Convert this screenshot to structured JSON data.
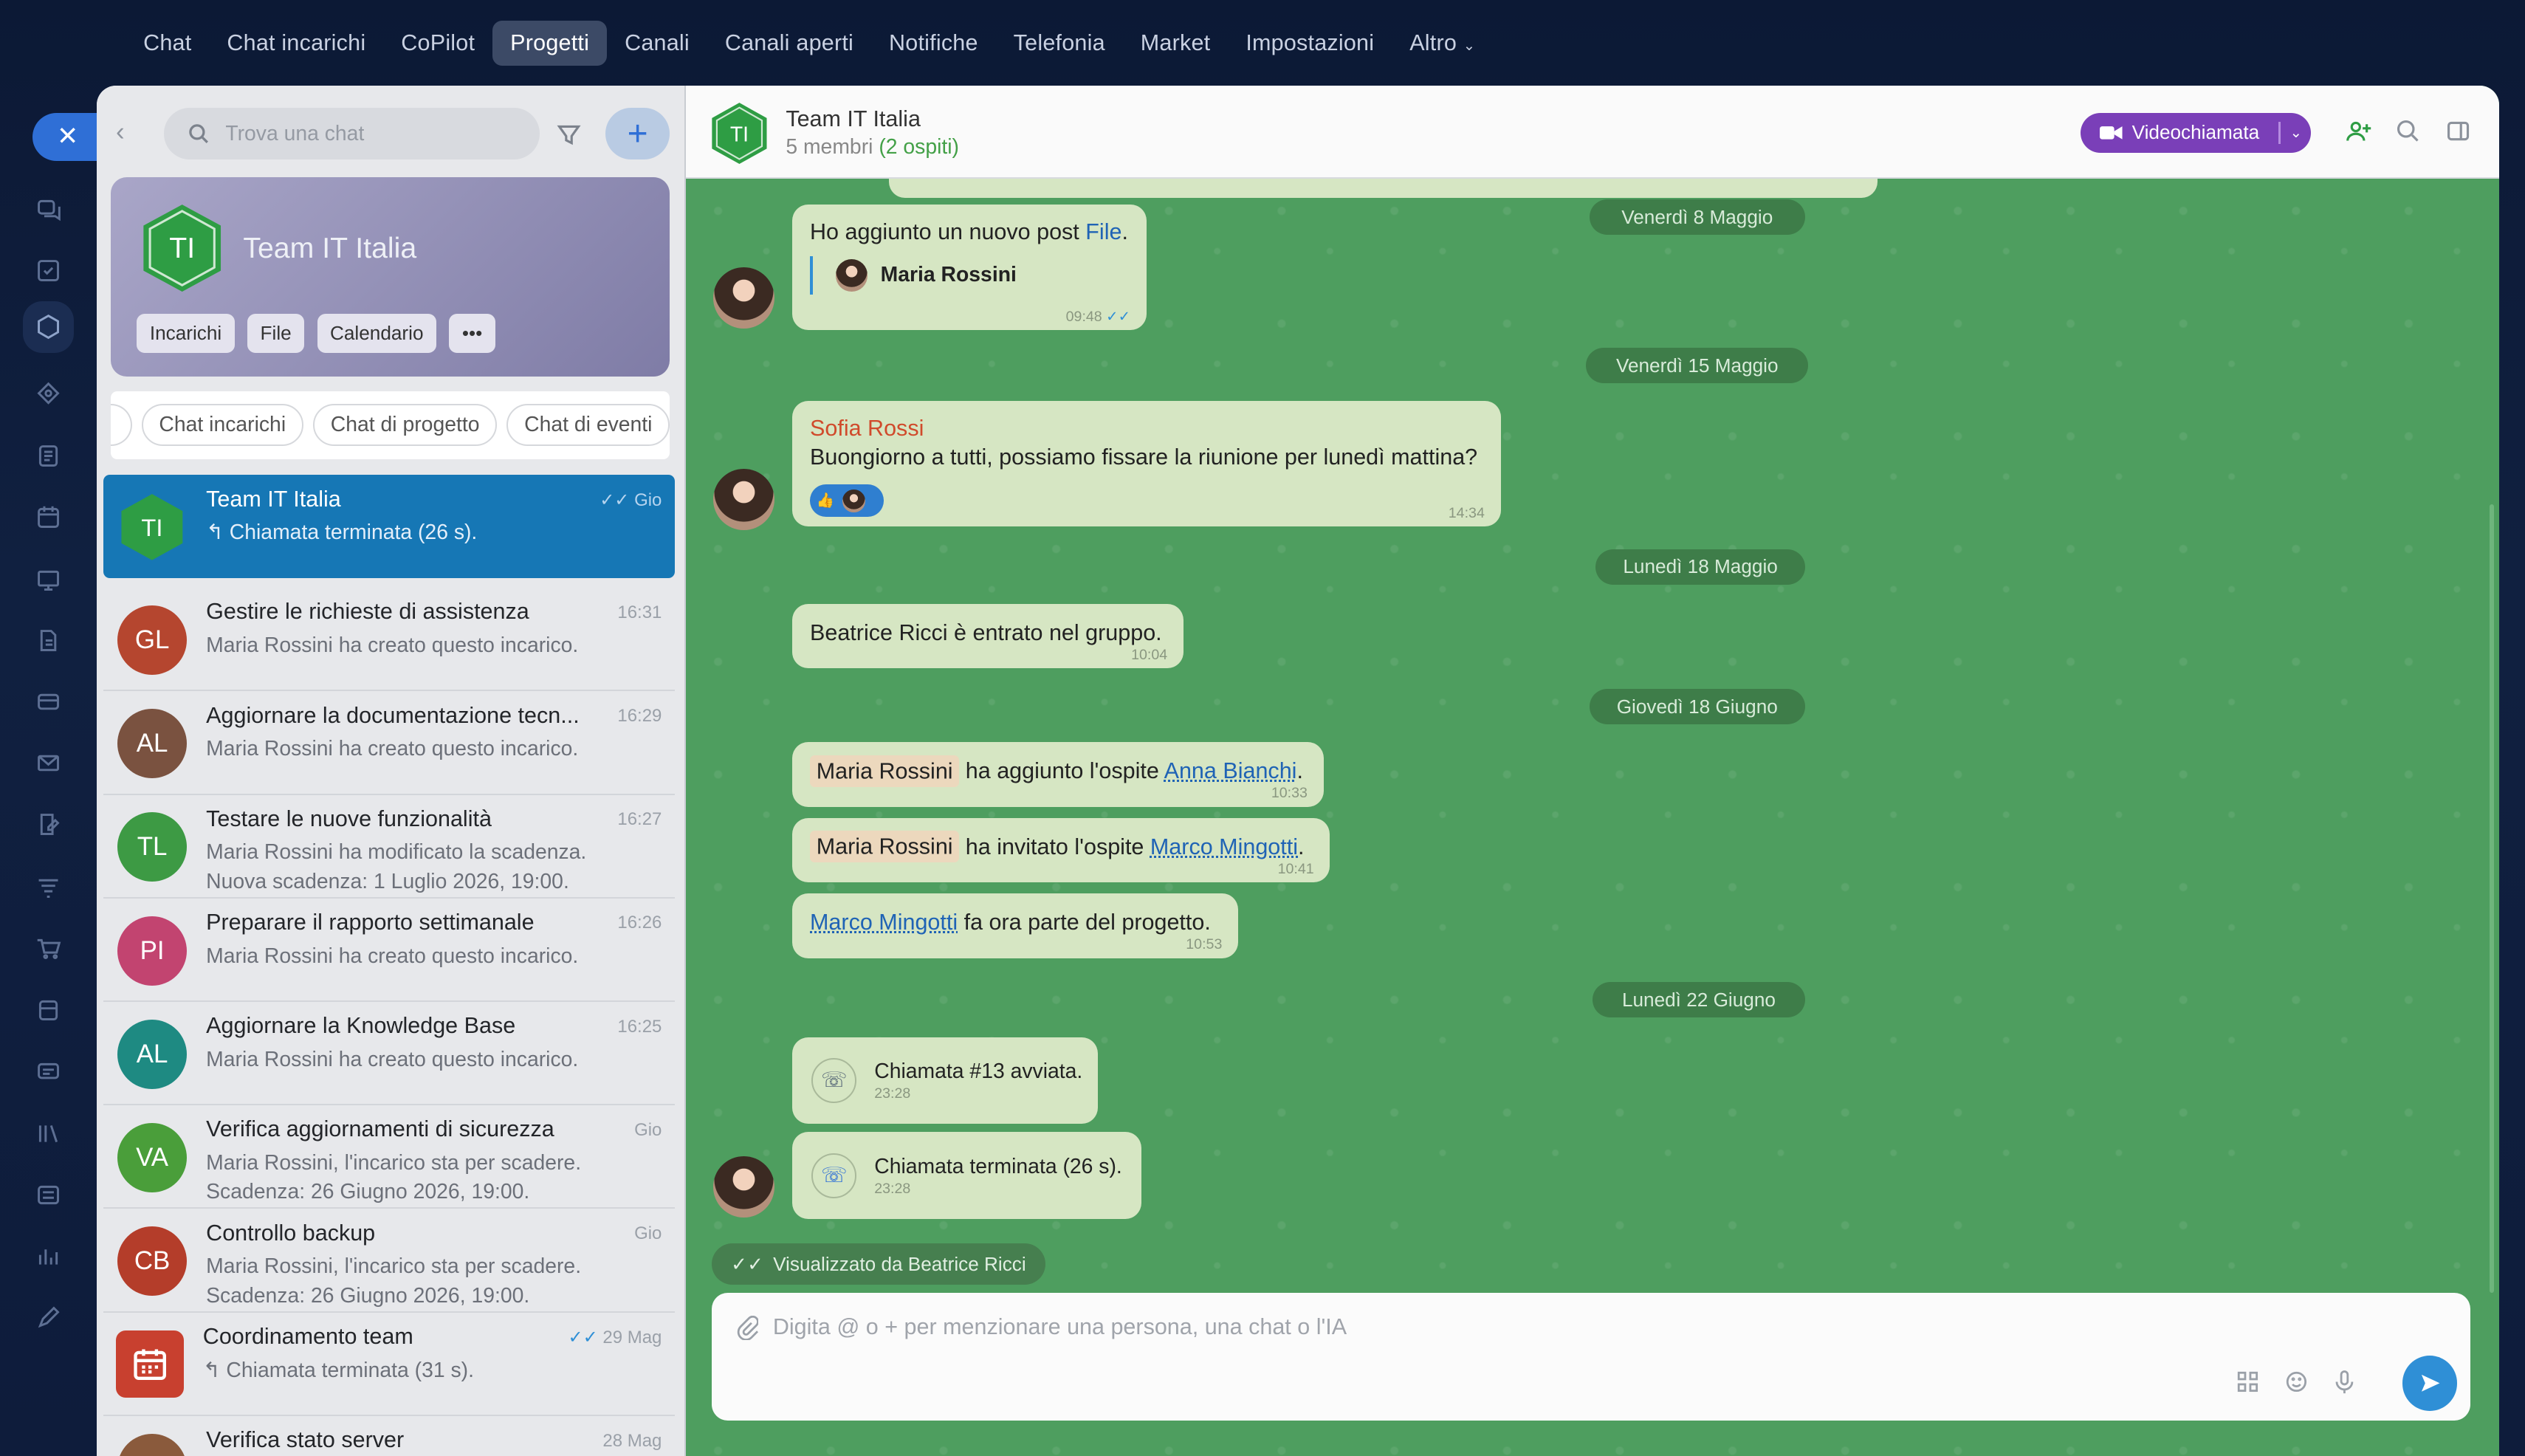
{
  "topnav": [
    "Chat",
    "Chat incarichi",
    "CoPilot",
    "Progetti",
    "Canali",
    "Canali aperti",
    "Notifiche",
    "Telefonia",
    "Market",
    "Impostazioni",
    "Altro"
  ],
  "search": {
    "placeholder": "Trova una chat"
  },
  "project": {
    "initials": "TI",
    "name": "Team IT Italia",
    "buttons": [
      "Incarichi",
      "File",
      "Calendario"
    ],
    "more": "•••"
  },
  "chips": [
    "Chat incarichi",
    "Chat di progetto",
    "Chat di eventi"
  ],
  "chats": [
    {
      "initials": "TI",
      "title": "Team IT Italia",
      "sub": "Chiamata terminata (26 s).",
      "time": "Gio",
      "color": "#2e9d44",
      "active": true
    },
    {
      "initials": "GL",
      "title": "Gestire le richieste di assistenza",
      "sub": "Maria Rossini ha creato questo incarico.",
      "time": "16:31",
      "color": "#b5462f"
    },
    {
      "initials": "AL",
      "title": "Aggiornare la documentazione tecn...",
      "sub": "Maria Rossini ha creato questo incarico.",
      "time": "16:29",
      "color": "#7a5240"
    },
    {
      "initials": "TL",
      "title": "Testare le nuove funzionalità",
      "sub": "Maria Rossini ha modificato la scadenza.",
      "sub2": "Nuova scadenza: 1 Luglio 2026, 19:00.",
      "time": "16:27",
      "color": "#3d9a44"
    },
    {
      "initials": "PI",
      "title": "Preparare il rapporto settimanale",
      "sub": "Maria Rossini ha creato questo incarico.",
      "time": "16:26",
      "color": "#c24470"
    },
    {
      "initials": "AL",
      "title": "Aggiornare la Knowledge Base",
      "sub": "Maria Rossini ha creato questo incarico.",
      "time": "16:25",
      "color": "#1e8a82"
    },
    {
      "initials": "VA",
      "title": "Verifica aggiornamenti di sicurezza",
      "sub": "Maria Rossini, l'incarico sta per scadere.",
      "sub2": "Scadenza: 26 Giugno 2026, 19:00.",
      "time": "Gio",
      "color": "#4a9e3a"
    },
    {
      "initials": "CB",
      "title": "Controllo backup",
      "sub": "Maria Rossini, l'incarico sta per scadere.",
      "sub2": "Scadenza: 26 Giugno 2026, 19:00.",
      "time": "Gio",
      "color": "#b43d2a"
    },
    {
      "initials": "",
      "title": "Coordinamento team",
      "sub": "Chiamata terminata (31 s).",
      "time": "29 Mag",
      "color": "#c8402f"
    },
    {
      "initials": "",
      "title": "Verifica stato server",
      "sub": "",
      "time": "28 Mag",
      "color": "#8a5a3c"
    }
  ],
  "header": {
    "title": "Team IT Italia",
    "members": "5 membri",
    "guests": "(2 ospiti)",
    "video": "Videochiamata"
  },
  "messages": {
    "d1": "Venerdì 8 Maggio",
    "m1": "Ho aggiunto un nuovo post",
    "m1_link": "File",
    "m1_author": "Maria Rossini",
    "m1_time": "09:48",
    "d2": "Venerdì 15 Maggio",
    "m2_name": "Sofia Rossi",
    "m2_text": "Buongiorno a tutti, possiamo fissare la riunione per lunedì mattina?",
    "m2_time": "14:34",
    "d3": "Lunedì 18 Maggio",
    "m3": "Beatrice Ricci è entrato nel gruppo.",
    "m3_time": "10:04",
    "d4": "Giovedì 18 Giugno",
    "m4_who": "Maria Rossini",
    "m4_act": "ha aggiunto l'ospite",
    "m4_guest": "Anna Bianchi",
    "m4_time": "10:33",
    "m5_who": "Maria Rossini",
    "m5_act": "ha invitato l'ospite",
    "m5_guest": "Marco Mingotti",
    "m5_time": "10:41",
    "m6_guest": "Marco Mingotti",
    "m6_act": "fa ora parte del progetto.",
    "m6_time": "10:53",
    "d5": "Lunedì 22 Giugno",
    "c1": "Chiamata #13 avviata.",
    "c1_time": "23:28",
    "c2": "Chiamata terminata (26 s).",
    "c2_time": "23:28"
  },
  "seen": "Visualizzato da Beatrice Ricci",
  "composer": {
    "placeholder": "Digita @ o + per menzionare una persona, una chat o l'IA"
  }
}
